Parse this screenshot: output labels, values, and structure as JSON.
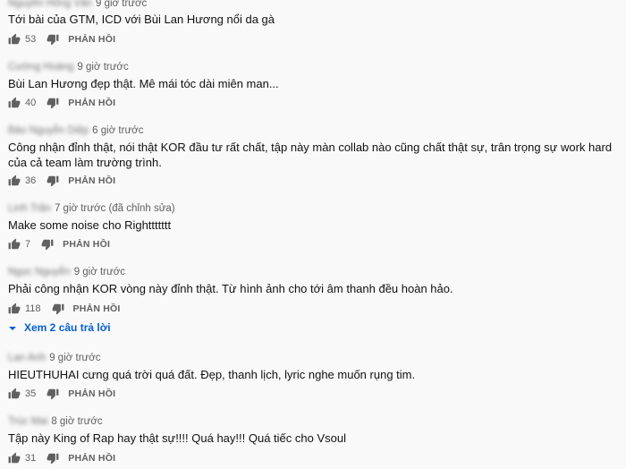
{
  "reply_label": "PHẢN HỒI",
  "comments": [
    {
      "author": "Nguyễn Hồng Vân",
      "time": "9 giờ trước",
      "text": "Tới bài của GTM, ICD với Bùi Lan Hương nổi da gà",
      "likes": "53"
    },
    {
      "author": "Cường Hoàng",
      "time": "9 giờ trước",
      "text": "Bùi Lan Hương đẹp thật. Mê mái tóc dài miên man...",
      "likes": "40"
    },
    {
      "author": "Bảo Nguyễn Diệp",
      "time": "6 giờ trước",
      "text": "Công nhận đỉnh thật, nói thật KOR đầu tư rất chất, tập này màn collab nào cũng chất thật sự, trân trọng sự work hard của cả team làm trường trình.",
      "likes": "36"
    },
    {
      "author": "Linh Trần",
      "time": "7 giờ trước (đã chỉnh sửa)",
      "text": "Make some noise cho Righttttttt",
      "likes": "7"
    },
    {
      "author": "Ngọc Nguyễn",
      "time": "9 giờ trước",
      "text": "Phải công nhận KOR vòng này đỉnh thật. Từ hình ảnh cho tới âm thanh đều hoàn hảo.",
      "likes": "118"
    },
    {
      "author": "Lan Anh",
      "time": "9 giờ trước",
      "text": "HIEUTHUHAI  cưng quá trời quá đất. Đẹp, thanh lịch, lyric nghe muốn rụng tim.",
      "likes": "35"
    },
    {
      "author": "Trúc Mai",
      "time": "8 giờ trước",
      "text": "Tập này King of Rap hay thật sự!!!! Quá hay!!! Quá tiếc cho Vsoul",
      "likes": "31"
    }
  ],
  "view_replies": "Xem 2 câu trả lời",
  "colors": {
    "link": "#065fd4",
    "muted": "#606060",
    "background": "#f9f9f9"
  },
  "icons": {
    "like": "thumbs-up-icon",
    "dislike": "thumbs-down-icon",
    "expand": "chevron-down-icon"
  }
}
